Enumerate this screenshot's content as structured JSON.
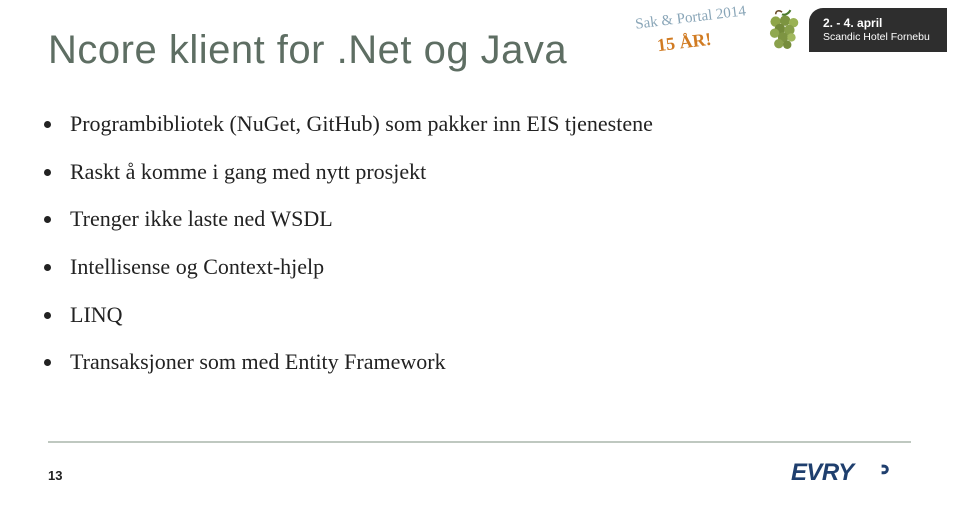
{
  "title": "Ncore klient for .Net og Java",
  "bullets": [
    "Programbibliotek (NuGet, GitHub) som pakker inn EIS tjenestene",
    "Raskt å komme i gang med nytt prosjekt",
    "Trenger ikke laste ned WSDL",
    "Intellisense og Context-hjelp",
    "LINQ",
    "Transaksjoner som med Entity Framework"
  ],
  "header": {
    "event_line1": "Sak & Portal 2014",
    "event_line2": "15 ÅR!",
    "date_line1": "2. - 4. april",
    "date_line2": "Scandic Hotel Fornebu"
  },
  "page_number": "13",
  "logo_text": "EVRY"
}
